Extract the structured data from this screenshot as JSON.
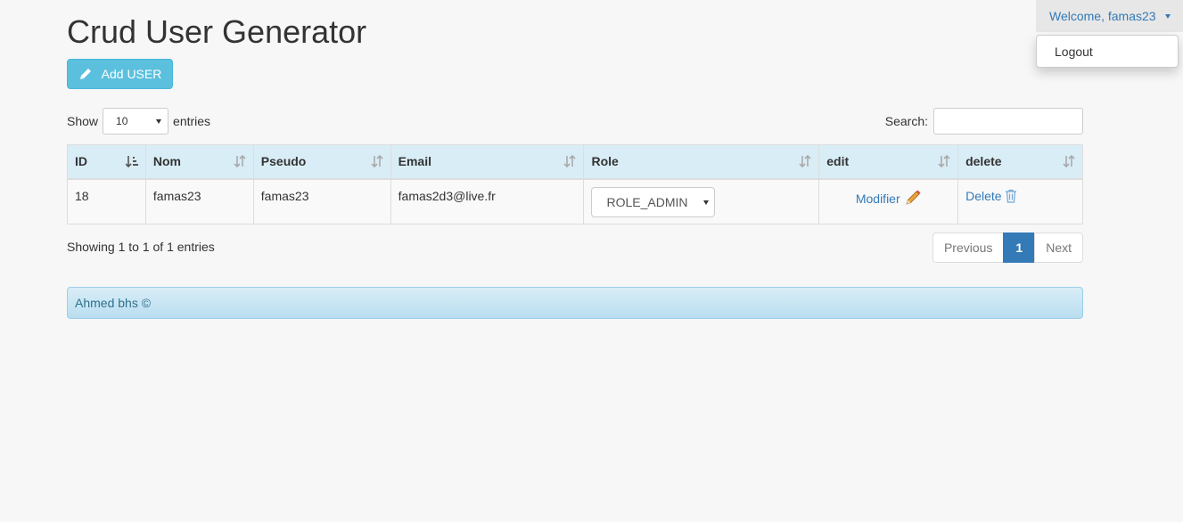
{
  "header": {
    "title": "Crud User Generator",
    "add_button": "Add USER"
  },
  "nav": {
    "welcome": "Welcome, famas23",
    "menu": {
      "logout": "Logout"
    }
  },
  "table_controls": {
    "show_label": "Show",
    "page_length": "10",
    "entries_label": "entries",
    "search_label": "Search:",
    "search_value": ""
  },
  "table": {
    "columns": [
      "ID",
      "Nom",
      "Pseudo",
      "Email",
      "Role",
      "edit",
      "delete"
    ],
    "rows": [
      {
        "id": "18",
        "nom": "famas23",
        "pseudo": "famas23",
        "email": "famas2d3@live.fr",
        "role": "ROLE_ADMIN",
        "edit": "Modifier",
        "delete": "Delete"
      }
    ]
  },
  "info": "Showing 1 to 1 of 1 entries",
  "pagination": {
    "previous": "Previous",
    "current": "1",
    "next": "Next"
  },
  "footer": "Ahmed bhs ©",
  "colors": {
    "accent": "#5bc0de",
    "primary": "#337ab7",
    "header_bg": "#d9edf7"
  }
}
